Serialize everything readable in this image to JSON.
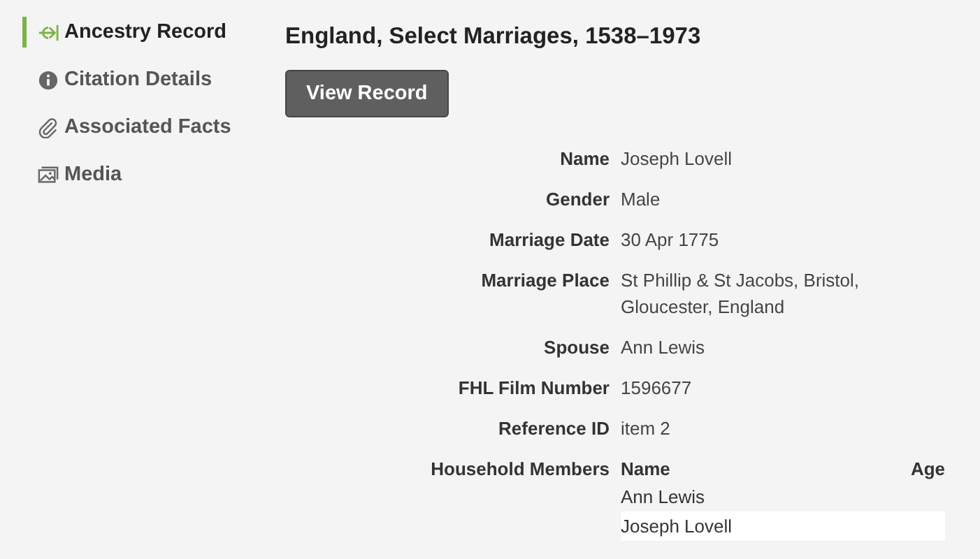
{
  "sidebar": {
    "items": [
      {
        "label": "Ancestry Record",
        "kind": "leaf",
        "selected": true
      },
      {
        "label": "Citation Details",
        "kind": "info",
        "selected": false
      },
      {
        "label": "Associated Facts",
        "kind": "clip",
        "selected": false
      },
      {
        "label": "Media",
        "kind": "photo",
        "selected": false
      }
    ]
  },
  "title": "England, Select Marriages, 1538–1973",
  "button": "View Record",
  "fields": [
    {
      "label": "Name",
      "value": "Joseph Lovell"
    },
    {
      "label": "Gender",
      "value": "Male"
    },
    {
      "label": "Marriage Date",
      "value": "30 Apr 1775"
    },
    {
      "label": "Marriage Place",
      "value": "St Phillip & St Jacobs, Bristol, Gloucester, England"
    },
    {
      "label": "Spouse",
      "value": "Ann Lewis"
    },
    {
      "label": "FHL Film Number",
      "value": "1596677"
    },
    {
      "label": "Reference ID",
      "value": "item 2"
    }
  ],
  "household": {
    "label": "Household Members",
    "columns": [
      "Name",
      "Age"
    ],
    "rows": [
      {
        "name": "Ann Lewis"
      },
      {
        "name": "Joseph Lovell"
      }
    ]
  }
}
